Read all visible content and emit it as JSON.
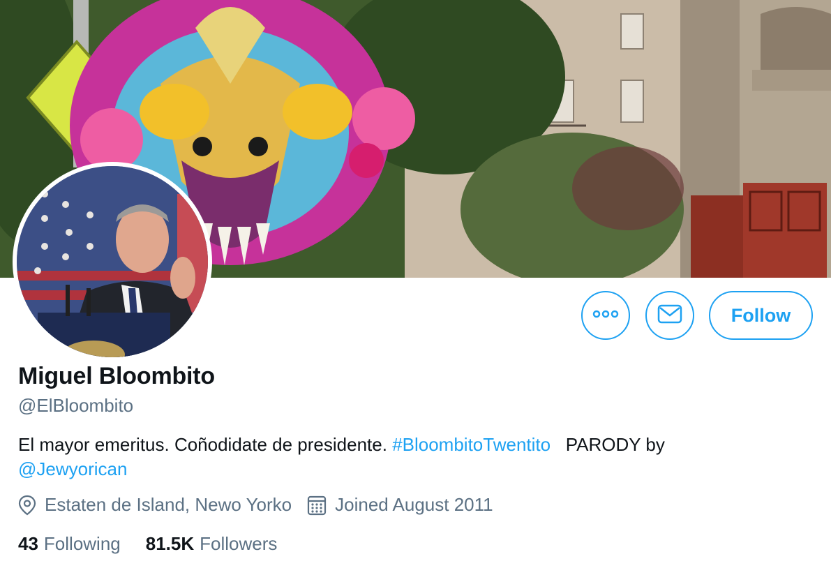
{
  "profile": {
    "display_name": "Miguel Bloombito",
    "handle": "@ElBloombito",
    "bio_text": "El mayor emeritus. Coñodidate de presidente. ",
    "bio_hashtag": "#BloombitoTwentito",
    "bio_parody": "   PARODY by",
    "bio_mention": "@Jewyorican",
    "location": "Estaten de Island, Newo Yorko",
    "joined": "Joined August 2011",
    "following_count": "43",
    "following_label": "Following",
    "followers_count": "81.5K",
    "followers_label": "Followers"
  },
  "actions": {
    "follow_label": "Follow",
    "more_icon": "more-icon",
    "mail_icon": "mail-icon"
  },
  "colors": {
    "accent": "#1da1f2",
    "text_primary": "#0f1419",
    "text_secondary": "#5b7083"
  }
}
